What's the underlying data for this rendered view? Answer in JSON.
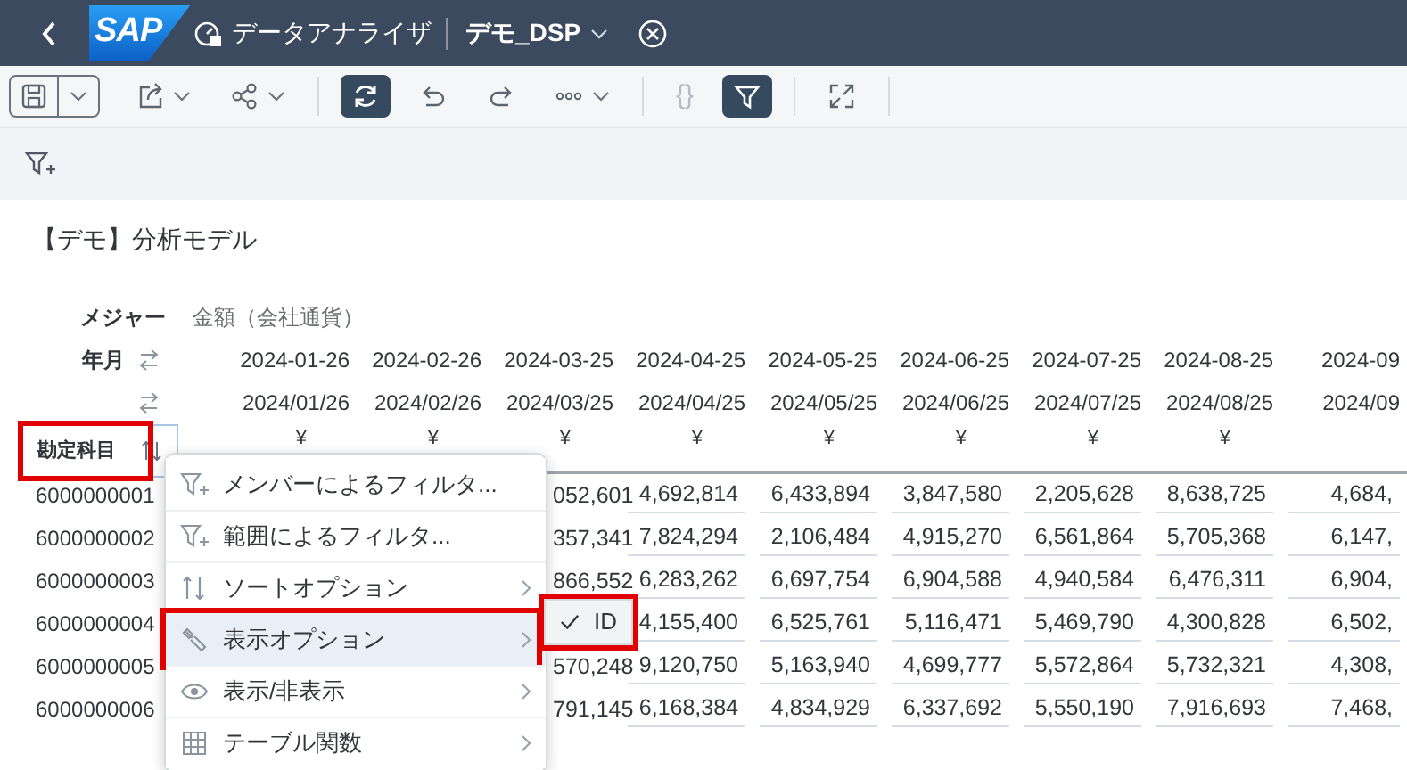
{
  "shell_bar": {
    "logo": "SAP",
    "app_title": "データアナライザ",
    "document_title": "デモ_DSP"
  },
  "toolbar": [
    {
      "kind": "save",
      "dropdown": true,
      "selected": false
    },
    {
      "kind": "export",
      "dropdown": true,
      "selected": false
    },
    {
      "kind": "share",
      "dropdown": true,
      "selected": false
    },
    {
      "kind": "separator"
    },
    {
      "kind": "refresh",
      "dropdown": false,
      "selected": true
    },
    {
      "kind": "undo",
      "dropdown": false,
      "selected": false
    },
    {
      "kind": "redo",
      "dropdown": false,
      "selected": false
    },
    {
      "kind": "more",
      "dropdown": true,
      "selected": false
    },
    {
      "kind": "separator"
    },
    {
      "kind": "braces",
      "label": "{}",
      "dropdown": false,
      "selected": false,
      "disabled": true
    },
    {
      "kind": "filter",
      "dropdown": false,
      "selected": true
    },
    {
      "kind": "separator"
    },
    {
      "kind": "fullscreen",
      "dropdown": false,
      "selected": false
    },
    {
      "kind": "separator"
    }
  ],
  "page_title": "【デモ】分析モデル",
  "table": {
    "measure_label": "メジャー",
    "measure": "金額（会社通貨）",
    "date_label": "年月",
    "columns": [
      {
        "date": "2024-01-26",
        "date_alt": "2024/01/26",
        "currency": "¥"
      },
      {
        "date": "2024-02-26",
        "date_alt": "2024/02/26",
        "currency": "¥"
      },
      {
        "date": "2024-03-25",
        "date_alt": "2024/03/25",
        "currency": "¥"
      },
      {
        "date": "2024-04-25",
        "date_alt": "2024/04/25",
        "currency": "¥"
      },
      {
        "date": "2024-05-25",
        "date_alt": "2024/05/25",
        "currency": "¥"
      },
      {
        "date": "2024-06-25",
        "date_alt": "2024/06/25",
        "currency": "¥"
      },
      {
        "date": "2024-07-25",
        "date_alt": "2024/07/25",
        "currency": "¥"
      },
      {
        "date": "2024-08-25",
        "date_alt": "2024/08/25",
        "currency": "¥"
      },
      {
        "date": "2024-09",
        "date_alt": "2024/09"
      }
    ],
    "row_header": {
      "label": "勘定科目",
      "annotated": true
    },
    "rows": [
      {
        "account": "6000000001",
        "partial_value": "052,601",
        "values": [
          "4,692,814",
          "6,433,894",
          "3,847,580",
          "2,205,628",
          "8,638,725",
          "4,684,"
        ]
      },
      {
        "account": "6000000002",
        "partial_value": "357,341",
        "values": [
          "7,824,294",
          "2,106,484",
          "4,915,270",
          "6,561,864",
          "5,705,368",
          "6,147,"
        ]
      },
      {
        "account": "6000000003",
        "partial_value": "866,552",
        "values": [
          "6,283,262",
          "6,697,754",
          "6,904,588",
          "4,940,584",
          "6,476,311",
          "6,904,"
        ]
      },
      {
        "account": "6000000004",
        "values": [
          "4,155,400",
          "6,525,761",
          "5,116,471",
          "5,469,790",
          "4,300,828",
          "6,502,"
        ]
      },
      {
        "account": "6000000005",
        "partial_value": "570,248",
        "values": [
          "9,120,750",
          "5,163,940",
          "4,699,777",
          "5,572,864",
          "5,732,321",
          "4,308,"
        ]
      },
      {
        "account": "6000000006",
        "partial_value": "791,145",
        "values": [
          "6,168,384",
          "4,834,929",
          "6,337,692",
          "5,550,190",
          "7,916,693",
          "7,468,"
        ]
      }
    ]
  },
  "context_menu": {
    "items": [
      {
        "kind": "filter",
        "label": "メンバーによるフィルタ...",
        "submenu": false,
        "selected": false,
        "annotated": false
      },
      {
        "kind": "filter",
        "label": "範囲によるフィルタ...",
        "submenu": false,
        "selected": false,
        "annotated": false
      },
      {
        "kind": "sort",
        "label": "ソートオプション",
        "submenu": true,
        "selected": false,
        "annotated": false
      },
      {
        "kind": "wrench",
        "label": "表示オプション",
        "submenu": true,
        "selected": true,
        "annotated": true
      },
      {
        "kind": "eye",
        "label": "表示/非表示",
        "submenu": true,
        "selected": false,
        "annotated": false
      },
      {
        "kind": "grid",
        "label": "テーブル関数",
        "submenu": true,
        "selected": false,
        "annotated": false
      }
    ]
  },
  "submenu": {
    "items": [
      {
        "label": "ID",
        "checked": true,
        "annotated": true
      }
    ]
  }
}
